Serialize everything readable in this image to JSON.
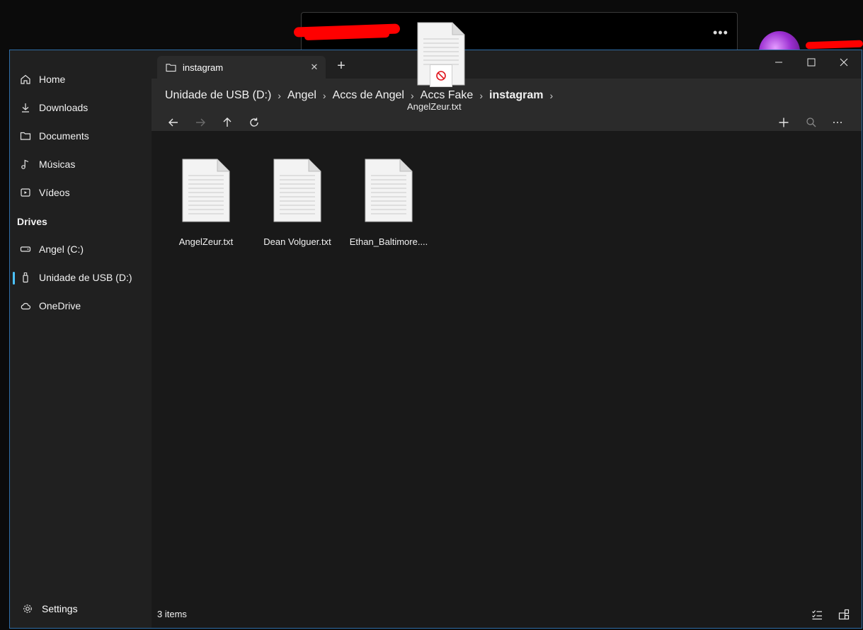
{
  "tab": {
    "title": "instagram",
    "close_glyph": "✕",
    "new_glyph": "+"
  },
  "window_controls": {
    "minimize": "—",
    "maximize": "☐",
    "close": "✕"
  },
  "sidebar": {
    "items": [
      {
        "label": "Home",
        "icon": "home-icon"
      },
      {
        "label": "Downloads",
        "icon": "download-icon"
      },
      {
        "label": "Documents",
        "icon": "folder-icon"
      },
      {
        "label": "Músicas",
        "icon": "music-icon"
      },
      {
        "label": "Vídeos",
        "icon": "video-icon"
      }
    ],
    "drives_title": "Drives",
    "drives": [
      {
        "label": "Angel (C:)",
        "icon": "drive-icon"
      },
      {
        "label": "Unidade de USB (D:)",
        "icon": "usb-icon",
        "active": true
      },
      {
        "label": "OneDrive",
        "icon": "cloud-icon"
      }
    ],
    "settings_label": "Settings"
  },
  "breadcrumb": [
    "Unidade de USB (D:)",
    "Angel",
    "Accs de Angel",
    "Accs Fake",
    "instagram"
  ],
  "files": [
    {
      "name": "AngelZeur.txt"
    },
    {
      "name": "Dean Volguer.txt"
    },
    {
      "name": "Ethan_Baltimore...."
    }
  ],
  "status": {
    "count_text": "3 items"
  },
  "drag_ghost": {
    "label": "AngelZeur.txt"
  },
  "background": {
    "menu_glyph": "•••"
  },
  "colors": {
    "accent": "#4cc2ff",
    "window_border": "#2f6ea8",
    "redaction": "#ff0000"
  }
}
